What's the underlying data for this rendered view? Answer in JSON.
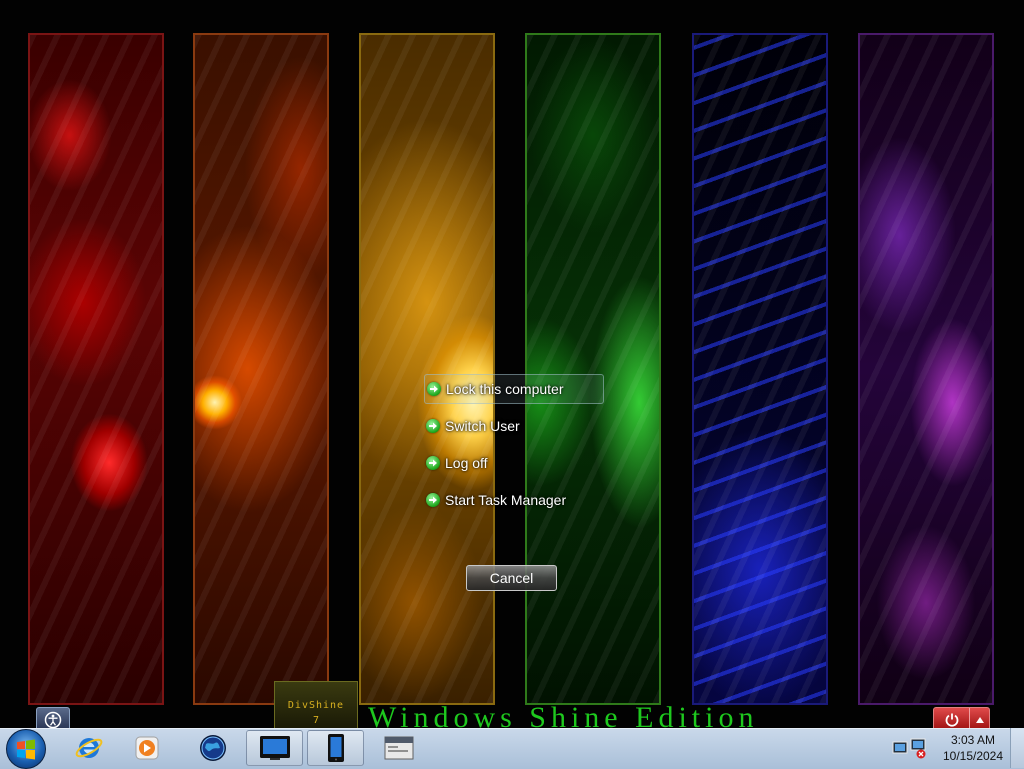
{
  "security_menu": {
    "items": [
      {
        "label": "Lock this computer"
      },
      {
        "label": "Switch User"
      },
      {
        "label": "Log off"
      },
      {
        "label": "Start Task Manager"
      }
    ],
    "cancel_label": "Cancel"
  },
  "wallpaper": {
    "logo_text": "DivShine",
    "logo_number": "7",
    "caption": "Windows Shine Edition",
    "panel_colors": [
      "#c01010",
      "#ff6a00",
      "#f0b000",
      "#20c020",
      "#2030e0",
      "#a030c0"
    ]
  },
  "taskbar": {
    "pinned_icons": [
      "internet-explorer-icon",
      "media-player-icon",
      "globe-app-icon",
      "monitor-app-icon",
      "tablet-app-icon",
      "window-app-icon"
    ],
    "clock": {
      "time": "3:03 AM",
      "date": "10/15/2024"
    }
  },
  "colors": {
    "accent_green": "#1ec81e",
    "power_red": "#c82020",
    "taskbar": "#b8cce2"
  }
}
